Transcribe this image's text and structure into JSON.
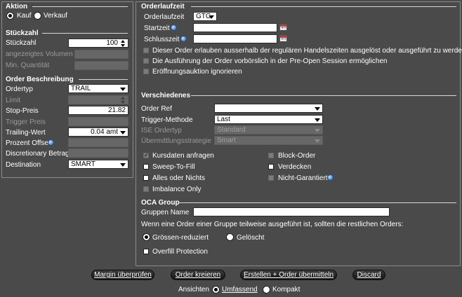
{
  "aktion": {
    "title": "Aktion",
    "kauf": "Kauf",
    "verkauf": "Verkauf",
    "selected": "Kauf"
  },
  "stueckzahl": {
    "title": "Stückzahl",
    "label": "Stückzahl",
    "value": "100",
    "angezeigtes_label": "angezeigtes Volumen",
    "min_label": "Min. Quantität"
  },
  "order_beschreibung": {
    "title": "Order Beschreibung",
    "ordertyp_label": "Ordertyp",
    "ordertyp_value": "TRAIL",
    "limit_label": "Limit",
    "stop_label": "Stop-Preis",
    "stop_value": "21.82",
    "trigger_label": "Trigger Preis",
    "trailing_label": "Trailing-Wert",
    "trailing_value": "0.04 amt",
    "prozent_label": "Prozent Offset",
    "discretionary_label": "Discretionary Betrag",
    "destination_label": "Destination",
    "destination_value": "SMART"
  },
  "orderlaufzeit": {
    "title": "Orderlaufzeit",
    "label": "Orderlaufzeit",
    "value": "GTC",
    "startzeit_label": "Startzeit",
    "schlusszeit_label": "Schlusszeit",
    "checkbox1": "Dieser Order erlauben ausserhalb der regulären Handelszeiten ausgelöst oder ausgeführt zu werden",
    "checkbox2": "Die Ausführung der Order vorbörslich in der Pre-Open Session ermöglichen",
    "checkbox3": "Eröffnungsauktion ignorieren"
  },
  "verschiedenes": {
    "title": "Verschiedenes",
    "order_ref_label": "Order Ref",
    "trigger_methode_label": "Trigger-Methode",
    "trigger_methode_value": "Last",
    "ise_label": "ISE Ordertyp",
    "ise_value": "Standard",
    "uebermittlung_label": "Übermittlungsstrategie",
    "uebermittlung_value": "Smart",
    "kursdaten": "Kursdaten anfragen",
    "sweep": "Sweep-To-Fill",
    "alles_oder_nichts": "Alles oder Nichts",
    "imbalance": "Imbalance Only",
    "block": "Block-Order",
    "verdecken": "Verdecken",
    "nicht_garantiert": "Nicht-Garantiert"
  },
  "oca": {
    "title": "OCA Group",
    "gruppen_label": "Gruppen Name",
    "description": "Wenn eine Order einer Gruppe teilweise ausgeführt ist, sollten die restlichen Orders:",
    "groessen": "Grössen-reduziert",
    "geloescht": "Gelöscht",
    "overfill": "Overfill Protection"
  },
  "buttons": {
    "margin": "Margin überprüfen",
    "kreieren": "Order kreieren",
    "erstellen": "Erstellen + Order übermitteln",
    "discard": "Discard"
  },
  "ansichten": {
    "label": "Ansichten",
    "umfassend": "Umfassend",
    "kompakt": "Kompakt",
    "selected": "Umfassend"
  }
}
